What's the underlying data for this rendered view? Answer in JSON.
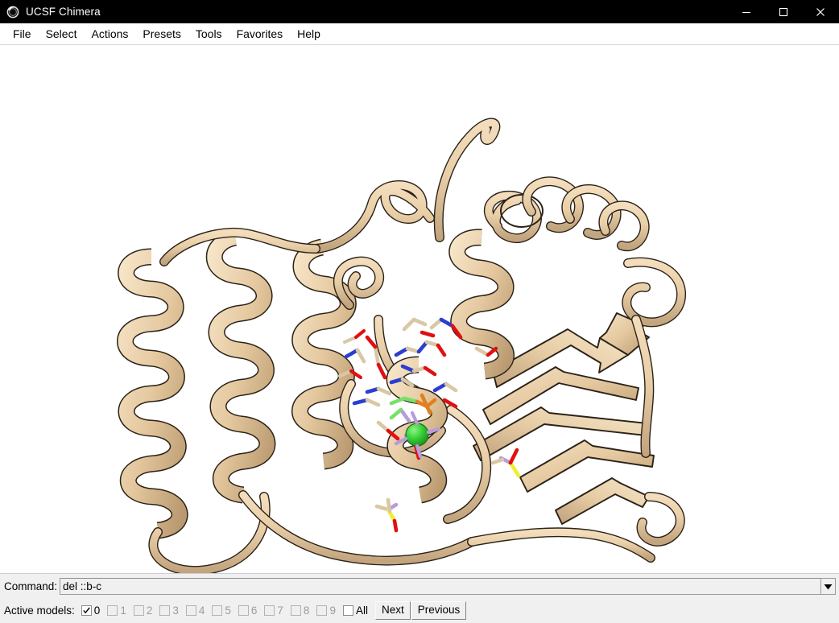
{
  "window": {
    "title": "UCSF Chimera",
    "icon": "chimera-sphere-icon",
    "controls": {
      "minimize": "minimize-icon",
      "maximize": "maximize-icon",
      "close": "close-icon"
    }
  },
  "menubar": {
    "items": [
      {
        "label": "File"
      },
      {
        "label": "Select"
      },
      {
        "label": "Actions"
      },
      {
        "label": "Presets"
      },
      {
        "label": "Tools"
      },
      {
        "label": "Favorites"
      },
      {
        "label": "Help"
      }
    ]
  },
  "viewport": {
    "background": "#ffffff",
    "representation": "ribbon cartoon with ball-and-stick residues",
    "ribbon_color": "#e9cfa8",
    "ribbon_shadow_color": "#bfa27c",
    "outline_color": "#2b2218",
    "ion_color": "#33cc33",
    "atom_colors": {
      "carbon": "#d9c7a5",
      "oxygen": "#e11010",
      "nitrogen": "#2a3fd0",
      "sulfur": "#f0ee30",
      "phosphorus": "#e08020",
      "ligand_carbon": "#77e06a",
      "bond_link": "#b79bdc"
    }
  },
  "command_bar": {
    "label": "Command:",
    "value": "del ::b-c",
    "placeholder": "",
    "dropdown_icon": "chevron-down-icon"
  },
  "active_models": {
    "label": "Active models:",
    "checkboxes": [
      {
        "label": "0",
        "checked": true,
        "enabled": true
      },
      {
        "label": "1",
        "checked": false,
        "enabled": false
      },
      {
        "label": "2",
        "checked": false,
        "enabled": false
      },
      {
        "label": "3",
        "checked": false,
        "enabled": false
      },
      {
        "label": "4",
        "checked": false,
        "enabled": false
      },
      {
        "label": "5",
        "checked": false,
        "enabled": false
      },
      {
        "label": "6",
        "checked": false,
        "enabled": false
      },
      {
        "label": "7",
        "checked": false,
        "enabled": false
      },
      {
        "label": "8",
        "checked": false,
        "enabled": false
      },
      {
        "label": "9",
        "checked": false,
        "enabled": false
      },
      {
        "label": "All",
        "checked": false,
        "enabled": true
      }
    ],
    "next_label": "Next",
    "previous_label": "Previous"
  }
}
